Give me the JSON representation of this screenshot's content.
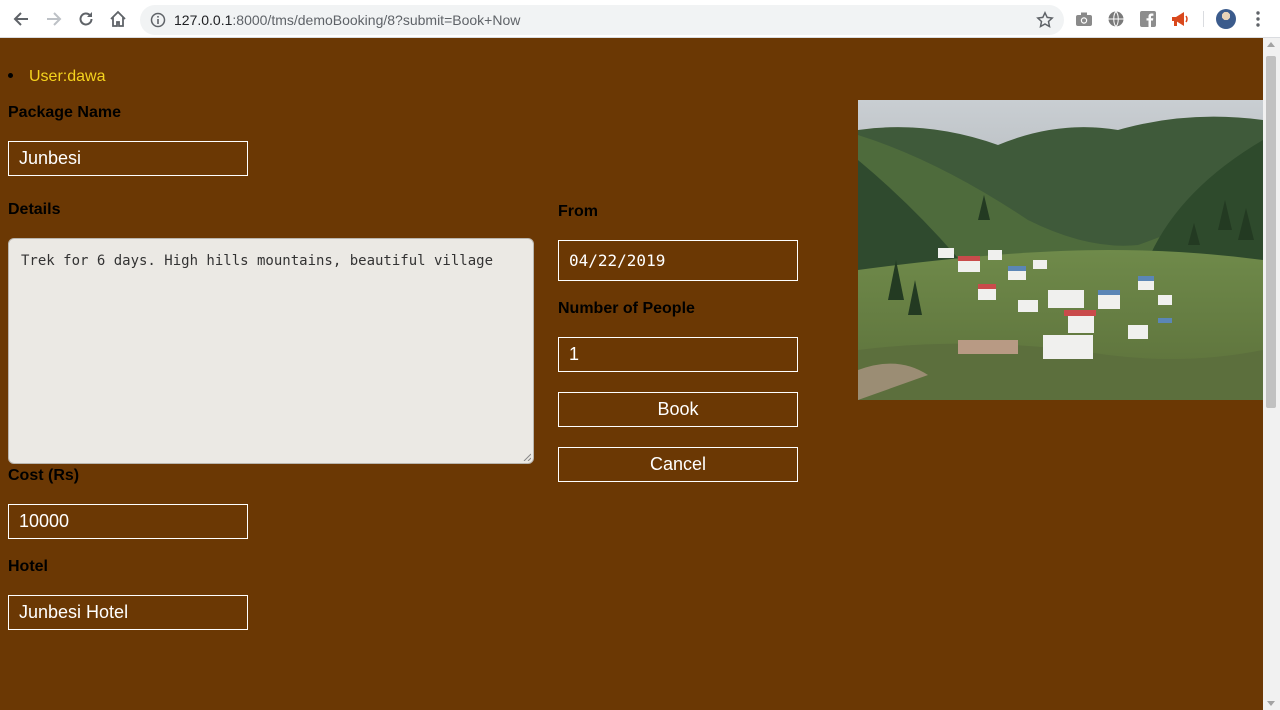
{
  "browser": {
    "url_host": "127.0.0.1",
    "url_rest": ":8000/tms/demoBooking/8?submit=Book+Now"
  },
  "user": {
    "label": "User:dawa"
  },
  "form": {
    "package_name_label": "Package Name",
    "package_name_value": "Junbesi",
    "details_label": "Details",
    "details_value": "Trek for 6 days. High hills mountains, beautiful village",
    "cost_label": "Cost (Rs)",
    "cost_value": "10000",
    "hotel_label": "Hotel",
    "hotel_value": "Junbesi Hotel",
    "from_label": "From",
    "from_value": "04/22/2019",
    "people_label": "Number of People",
    "people_value": "1",
    "book_label": "Book",
    "cancel_label": "Cancel"
  },
  "colors": {
    "page_background": "#6b3804",
    "user_text": "#f5d31e",
    "field_border": "#ffffff"
  },
  "icons": [
    "back-icon",
    "forward-icon",
    "reload-icon",
    "home-icon",
    "info-icon",
    "star-icon",
    "camera-icon",
    "globe-icon",
    "facebook-icon",
    "megaphone-icon",
    "menu-icon"
  ]
}
